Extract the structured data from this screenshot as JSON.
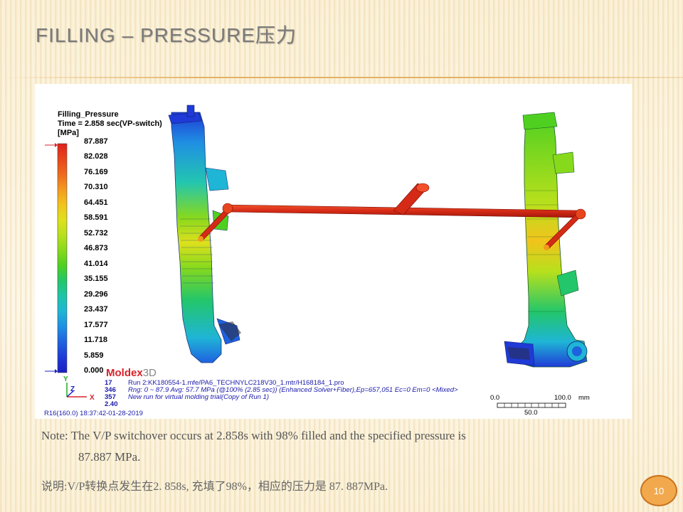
{
  "slide": {
    "title_main": "Filling – Pressure",
    "title_cn": "压力",
    "page_number": "10"
  },
  "figure": {
    "legend": {
      "title_line1": "Filling_Pressure",
      "title_line2": "Time = 2.858 sec(VP-switch)",
      "unit": "[MPa]",
      "values": [
        "87.887",
        "82.028",
        "76.169",
        "70.310",
        "64.451",
        "58.591",
        "52.732",
        "46.873",
        "41.014",
        "35.155",
        "29.296",
        "23.437",
        "17.577",
        "11.718",
        "5.859",
        "0.000"
      ],
      "colors": [
        "#e0221c",
        "#e8451d",
        "#ef6a1d",
        "#f39a1e",
        "#f2c31c",
        "#dfe01c",
        "#b8e01c",
        "#87d91c",
        "#4fd021",
        "#23c66a",
        "#1fc4a8",
        "#1fb5d6",
        "#1f8fe3",
        "#1f62e0",
        "#1f3ad6",
        "#1a20c4"
      ]
    },
    "brand": {
      "name_bold": "Moldex",
      "name_light": "3D"
    },
    "run_info": {
      "nums": [
        "17",
        "346",
        "357",
        "2.40"
      ],
      "line1": "Run 2:KK180554-1.mfe/PA6_TECHNYLC218V30_1.mtr/H168184_1.pro",
      "line2": "Rng: 0 ~ 87.9   Avg: 57.7 MPa  (@100% (2.85 sec)) (Enhanced Solver+Fiber),Ep=657,051 Ec=0 Em=0 <Mixed>",
      "line3": "New run for virtual molding trial(Copy of Run 1)"
    },
    "stamp": "R16(160.0) 18:37:42-01-28-2019",
    "scale": {
      "start": "0.0",
      "end": "100.0",
      "unit": "mm",
      "mid": "50.0"
    },
    "axes": {
      "y": "Y",
      "z": "Z",
      "x": "X"
    }
  },
  "note": {
    "line1": "Note: The V/P switchover occurs at 2.858s with 98% filled and the specified pressure is",
    "line2": "87.887 MPa.",
    "cn": "说明:V/P转换点发生在2. 858s, 充填了98%，相应的压力是  87. 887MPa."
  }
}
